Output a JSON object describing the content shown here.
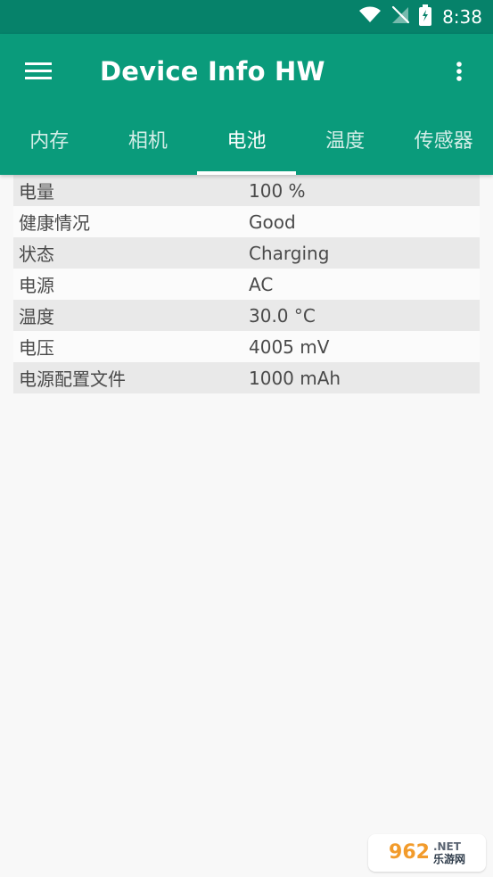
{
  "status_bar": {
    "time": "8:38",
    "icons": [
      "wifi-icon",
      "no-signal-icon",
      "battery-charging-icon"
    ]
  },
  "app_bar": {
    "menu_icon": "hamburger-menu-icon",
    "title": "Device Info HW",
    "overflow_icon": "more-vert-icon"
  },
  "tabs": [
    {
      "label": "内存",
      "active": false
    },
    {
      "label": "相机",
      "active": false
    },
    {
      "label": "电池",
      "active": true
    },
    {
      "label": "温度",
      "active": false
    },
    {
      "label": "传感器",
      "active": false
    }
  ],
  "battery_info": [
    {
      "label": "电量",
      "value": "100 %"
    },
    {
      "label": "健康情况",
      "value": "Good"
    },
    {
      "label": "状态",
      "value": "Charging"
    },
    {
      "label": "电源",
      "value": "AC"
    },
    {
      "label": "温度",
      "value": "30.0 °C"
    },
    {
      "label": "电压",
      "value": "4005 mV"
    },
    {
      "label": "电源配置文件",
      "value": "1000 mAh"
    }
  ],
  "watermark": {
    "left": "962",
    "top": ".NET",
    "bottom": "乐游网"
  },
  "colors": {
    "status_bar": "#06826a",
    "app_bar": "#0a9b7b",
    "background": "#f8f8f8",
    "row_alt": "#e9e9e9",
    "row_light": "#fbfbfb"
  }
}
